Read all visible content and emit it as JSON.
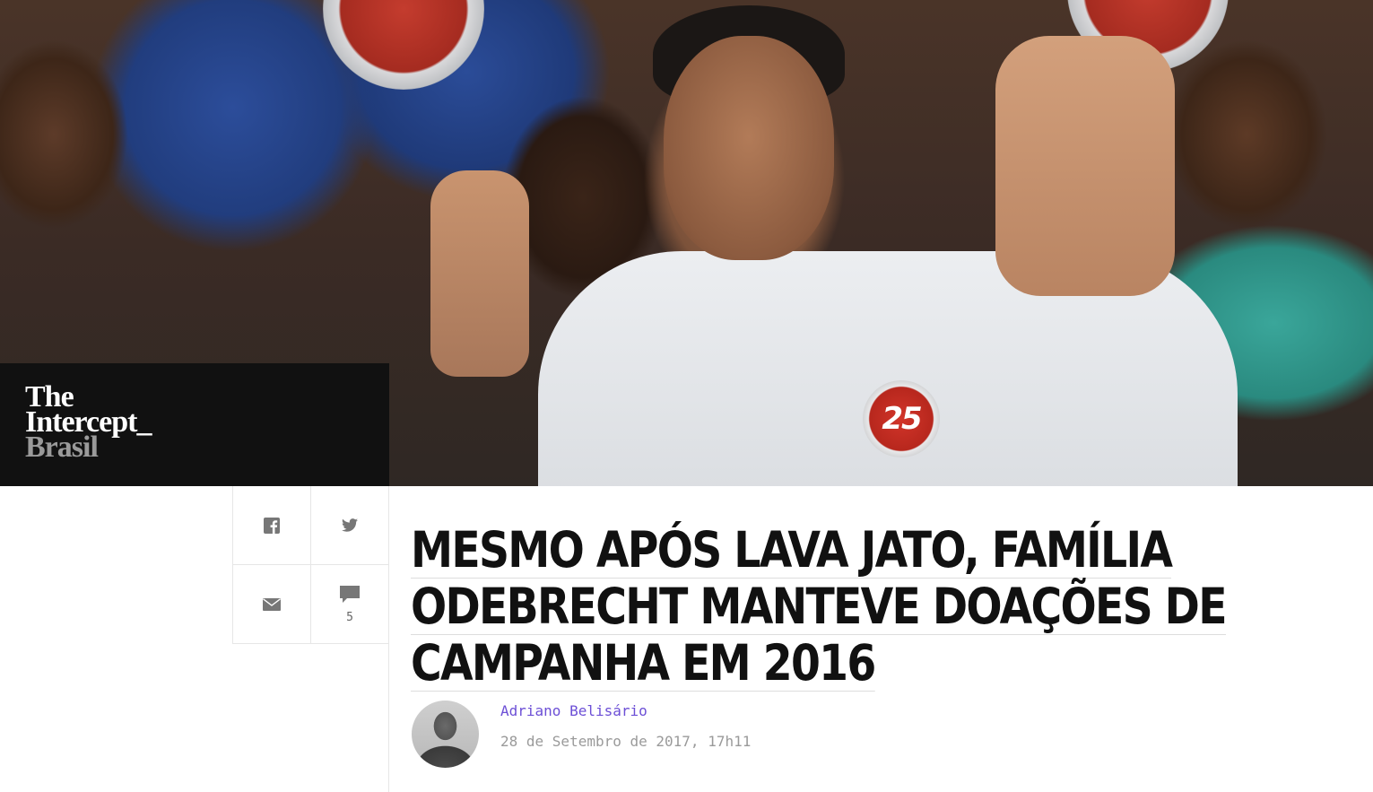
{
  "brand": {
    "line1": "The",
    "line2": "Intercept_",
    "line3": "Brasil"
  },
  "hero": {
    "campaign_number": "25"
  },
  "share": {
    "facebook_icon": "facebook-icon",
    "twitter_icon": "twitter-icon",
    "email_icon": "email-icon",
    "comment_icon": "comment-icon",
    "comment_count": "5"
  },
  "article": {
    "headline_lines": [
      "MESMO APÓS LAVA JATO, FAMÍLIA",
      "ODEBRECHT MANTEVE DOAÇÕES DE",
      "CAMPANHA EM 2016"
    ],
    "author": "Adriano Belisário",
    "date": "28 de Setembro de 2017, 17h11"
  },
  "colors": {
    "logo_bg": "#111111",
    "author_link": "#6c4fd6",
    "date_text": "#9a9a9a"
  }
}
